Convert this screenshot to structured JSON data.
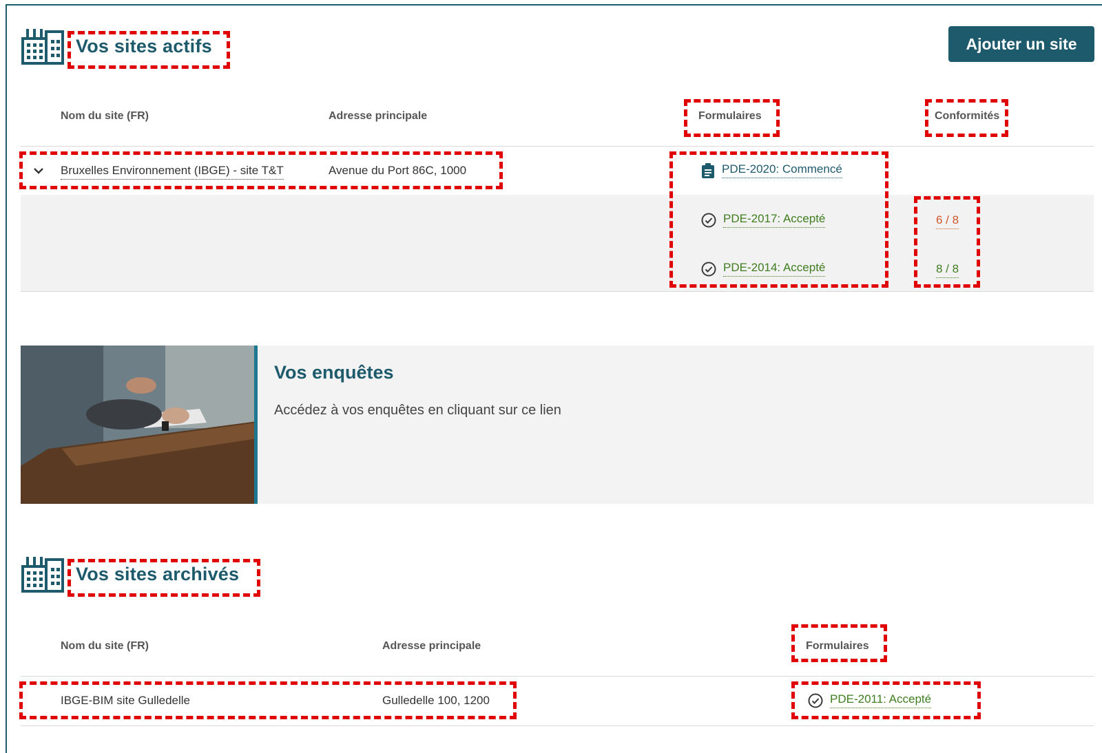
{
  "active": {
    "title": "Vos sites actifs",
    "add_button": "Ajouter un site",
    "headers": {
      "name": "Nom du site (FR)",
      "address": "Adresse principale",
      "forms": "Formulaires",
      "conformity": "Conformités"
    },
    "site": {
      "name": "Bruxelles Environnement (IBGE) - site T&T",
      "address": "Avenue du Port 86C, 1000"
    },
    "forms": [
      {
        "label": "PDE-2020: Commencé",
        "status": "started",
        "conformity": ""
      },
      {
        "label": "PDE-2017: Accepté",
        "status": "accepted",
        "conformity": "6 / 8"
      },
      {
        "label": "PDE-2014: Accepté",
        "status": "accepted",
        "conformity": "8 / 8"
      }
    ]
  },
  "survey": {
    "title": "Vos enquêtes",
    "description": "Accédez à vos enquêtes en cliquant sur ce lien"
  },
  "archived": {
    "title": "Vos sites archivés",
    "headers": {
      "name": "Nom du site (FR)",
      "address": "Adresse principale",
      "forms": "Formulaires"
    },
    "site": {
      "name": "IBGE-BIM site Gulledelle",
      "address": "Gulledelle 100, 1200",
      "form": "PDE-2011: Accepté"
    }
  },
  "colors": {
    "primary": "#1d5a6b",
    "accepted": "#3f7d1f",
    "warning": "#d0562b",
    "annotation": "#e10000"
  }
}
